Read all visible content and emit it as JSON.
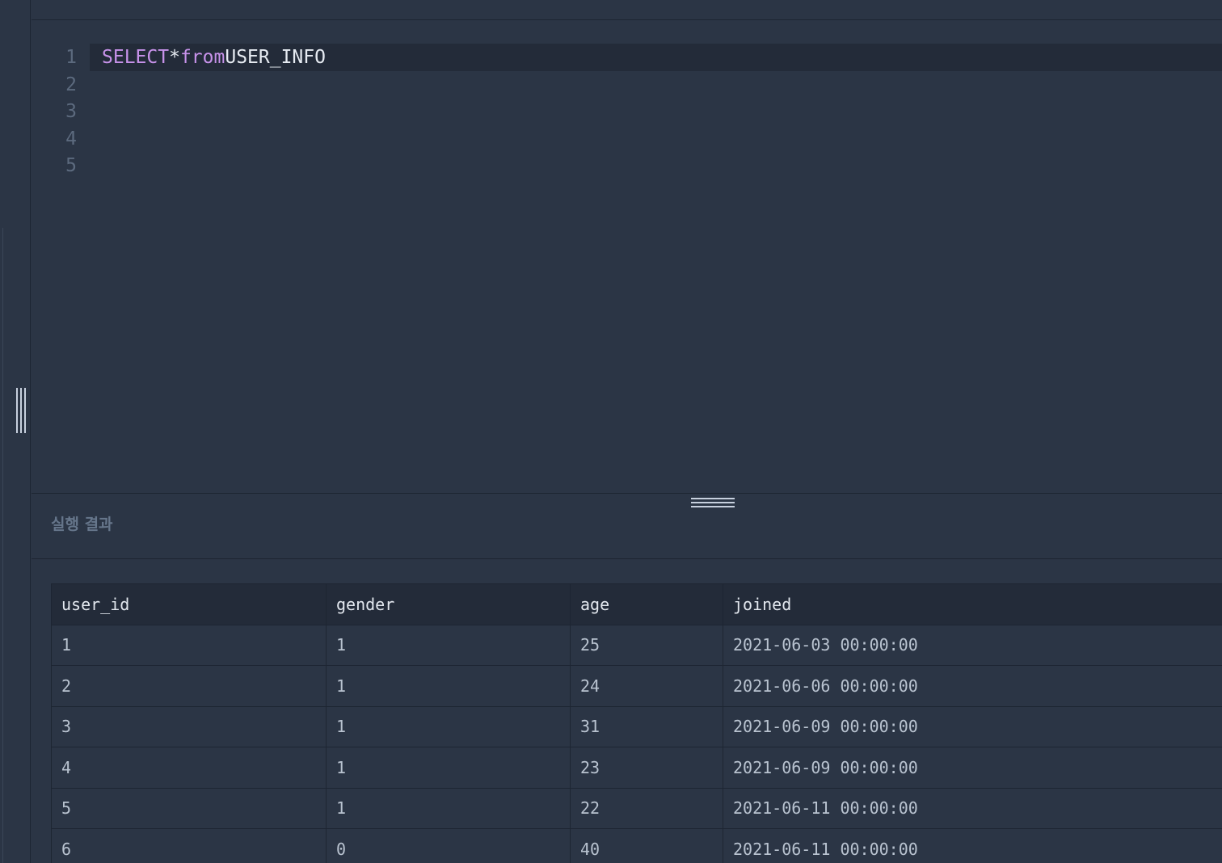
{
  "editor": {
    "lines": [
      {
        "number": "1",
        "tokens": {
          "kw1": "SELECT",
          "op": "*",
          "kw2": "from",
          "id": "USER_INFO"
        }
      },
      {
        "number": "2"
      },
      {
        "number": "3"
      },
      {
        "number": "4"
      },
      {
        "number": "5"
      }
    ]
  },
  "results": {
    "title": "실행 결과",
    "columns": [
      "user_id",
      "gender",
      "age",
      "joined"
    ],
    "rows": [
      [
        "1",
        "1",
        "25",
        "2021-06-03 00:00:00"
      ],
      [
        "2",
        "1",
        "24",
        "2021-06-06 00:00:00"
      ],
      [
        "3",
        "1",
        "31",
        "2021-06-09 00:00:00"
      ],
      [
        "4",
        "1",
        "23",
        "2021-06-09 00:00:00"
      ],
      [
        "5",
        "1",
        "22",
        "2021-06-11 00:00:00"
      ],
      [
        "6",
        "0",
        "40",
        "2021-06-11 00:00:00"
      ]
    ]
  },
  "colors": {
    "background": "#2b3545",
    "active_line": "#232b39",
    "keyword": "#c792ea",
    "text": "#e6ebf2",
    "muted": "#66768b"
  }
}
